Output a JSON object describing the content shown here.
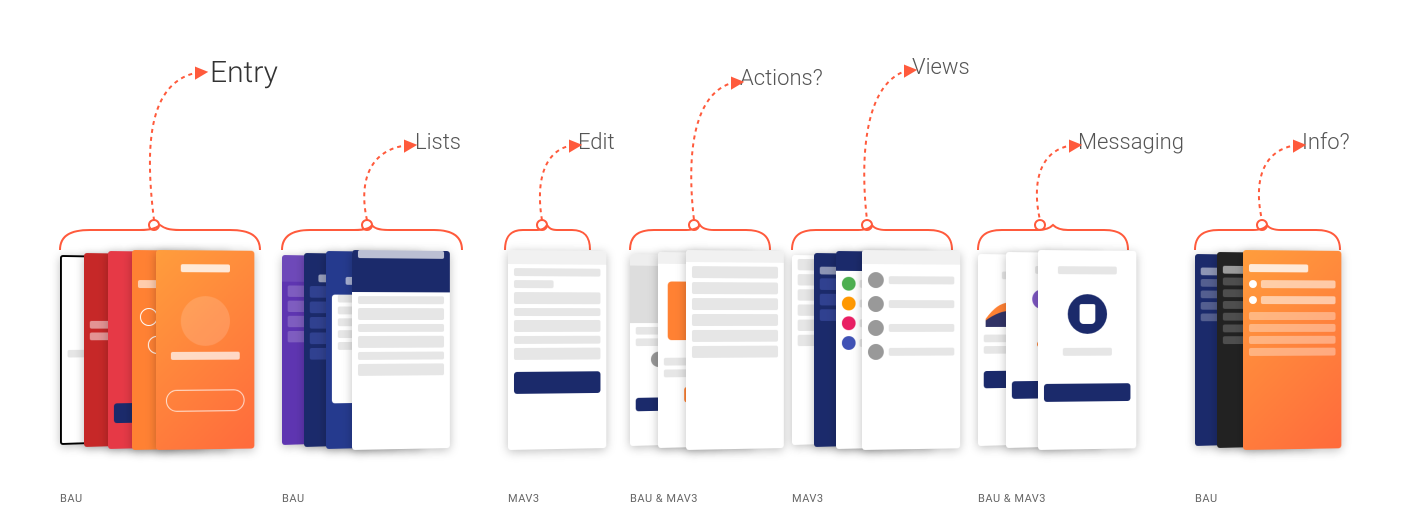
{
  "categories": [
    {
      "key": "entry",
      "label": "Entry",
      "caption": "BAU"
    },
    {
      "key": "lists",
      "label": "Lists",
      "caption": "BAU"
    },
    {
      "key": "edit",
      "label": "Edit",
      "caption": "MAV3"
    },
    {
      "key": "actions",
      "label": "Actions?",
      "caption": "BAU & MAV3"
    },
    {
      "key": "views",
      "label": "Views",
      "caption": "MAV3"
    },
    {
      "key": "messaging",
      "label": "Messaging",
      "caption": "BAU & MAV3"
    },
    {
      "key": "info",
      "label": "Info?",
      "caption": "BAU"
    }
  ],
  "colors": {
    "accent": "#ff5a3c",
    "navy": "#1b2a6b",
    "orange_gradient": [
      "#ff9d3c",
      "#ff6a3c"
    ]
  }
}
